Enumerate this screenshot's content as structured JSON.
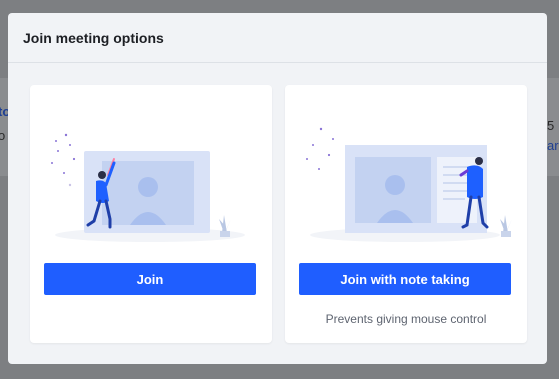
{
  "dialog": {
    "title": "Join meeting options",
    "options": [
      {
        "button_label": "Join",
        "description": ""
      },
      {
        "button_label": "Join with note taking",
        "description": "Prevents giving mouse control"
      }
    ]
  },
  "backdrop": {
    "fragments": [
      "to",
      "o",
      "5",
      "ar"
    ]
  },
  "colors": {
    "primary_button": "#1f5eff",
    "card_bg": "#ffffff",
    "dialog_bg": "#f1f3f6",
    "illustration_blue": "#d7e1f7"
  }
}
